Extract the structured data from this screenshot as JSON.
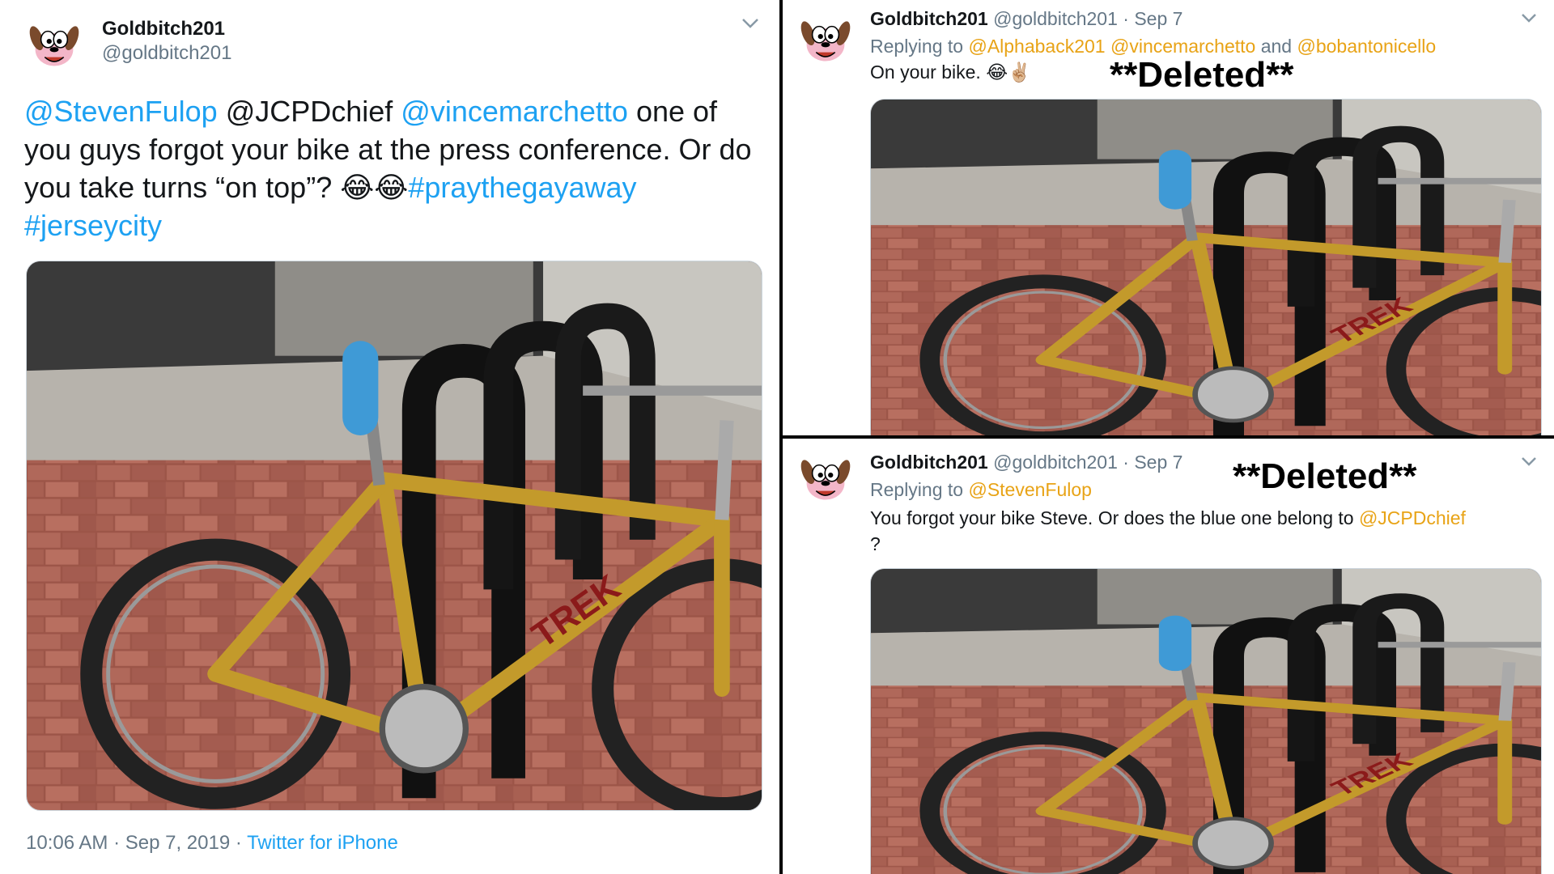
{
  "colors": {
    "link_blue": "#1da1f2",
    "reply_orange": "#e8a316",
    "muted": "#657786"
  },
  "main_tweet": {
    "avatar_icon": "courage-the-cowardly-dog-avatar",
    "display_name": "Goldbitch201",
    "handle": "@goldbitch201",
    "text_parts": {
      "m1": "@StevenFulop",
      "t1": " @JCPDchief ",
      "m2": "@vincemarchetto",
      "t2": " one of you guys forgot your bike at the press conference. Or do you take turns “on top”? ",
      "emoji": "😂😂",
      "h1": "#praythegayaway",
      "h2": "#jerseycity"
    },
    "photo": "bicycle-locked-to-rack-photo",
    "footer": {
      "time": "10:06 AM",
      "sep1": " · ",
      "date": "Sep 7, 2019",
      "sep2": " · ",
      "source": "Twitter for iPhone"
    }
  },
  "reply1": {
    "display_name": "Goldbitch201",
    "handle": "@goldbitch201",
    "dot": " · ",
    "date": "Sep 7",
    "replying_prefix": "Replying to ",
    "replying_1": "@Alphaback201",
    "replying_sp": " ",
    "replying_2": "@vincemarchetto",
    "replying_and": " and ",
    "replying_3": "@bobantonicello",
    "text": "On your bike. ",
    "emoji": "😂✌🏼",
    "deleted_label": "**Deleted**"
  },
  "reply2": {
    "display_name": "Goldbitch201",
    "handle": "@goldbitch201",
    "dot": " · ",
    "date": "Sep 7",
    "replying_prefix": "Replying to ",
    "replying_1": "@StevenFulop",
    "text": "You forgot your bike Steve. Or does the blue one belong to ",
    "mention": "@JCPDchief",
    "text_end": "?",
    "deleted_label": "**Deleted**"
  }
}
